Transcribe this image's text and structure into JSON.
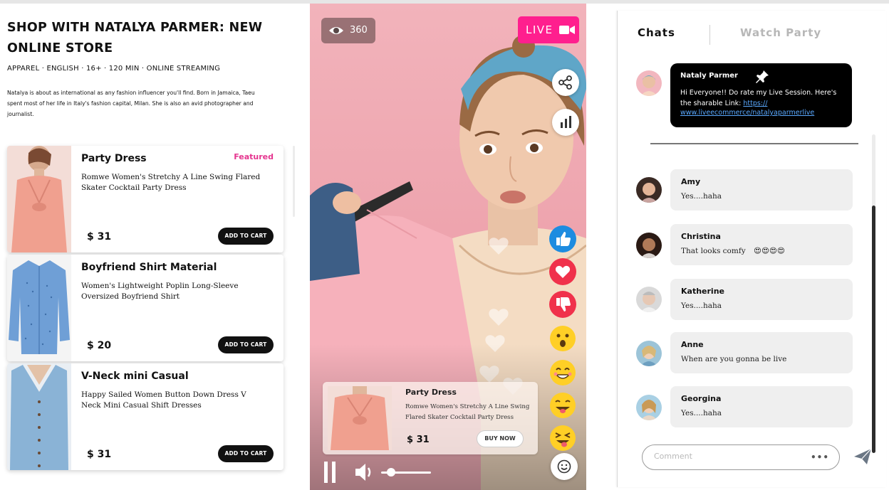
{
  "store": {
    "title": "SHOP WITH NATALYA PARMER: NEW ONLINE STORE",
    "meta": "APPAREL · ENGLISH · 16+ · 120 MIN · ONLINE STREAMING",
    "description": "Natalya is about as international as any fashion influencer you'll find. Born in Jamaica, Taeu spent most of her life in Italy's fashion capital, Milan. She is also an avid photographer and journalist."
  },
  "products": [
    {
      "name": "Party Dress",
      "badge": "Featured",
      "description": "Romwe Women's Stretchy A Line Swing Flared Skater Cocktail Party Dress",
      "price": "$ 31",
      "cart_label": "ADD TO CART"
    },
    {
      "name": "Boyfriend Shirt Material",
      "badge": "",
      "description": "Women's Lightweight Poplin Long-Sleeve Oversized Boyfriend Shirt",
      "price": "$ 20",
      "cart_label": "ADD TO CART"
    },
    {
      "name": "V-Neck mini Casual",
      "badge": "",
      "description": "Happy Sailed Women Button Down Dress V Neck Mini Casual Shift Dresses",
      "price": "$ 31",
      "cart_label": "ADD TO CART"
    }
  ],
  "video": {
    "viewer_count": "360",
    "live_label": "LIVE",
    "featured_product": {
      "name": "Party Dress",
      "description": "Romwe Women's Stretchy A Line Swing Flared Skater Cocktail Party Dress",
      "price": "$ 31",
      "buy_label": "BUY NOW"
    },
    "volume_level": 0.2,
    "reactions": [
      "thumbs-up-icon",
      "heart-icon",
      "thumbs-down-icon",
      "surprised-emoji",
      "smile-emoji",
      "tongue-emoji",
      "wink-tongue-emoji"
    ]
  },
  "chat": {
    "tabs": {
      "chats": "Chats",
      "watch_party": "Watch Party"
    },
    "pinned": {
      "author": "Nataly Parmer",
      "text": "Hi Everyone!! Do rate my Live Session. Here's the sharable Link:",
      "link_part1": "https://",
      "link_part2": "www.liveecommerce/natalyaparmerlive"
    },
    "messages": [
      {
        "user": "Amy",
        "text": "Yes....haha"
      },
      {
        "user": "Christina",
        "text": "That looks comfy",
        "emoji": "😍😍😍😍"
      },
      {
        "user": "Katherine",
        "text": "Yes....haha"
      },
      {
        "user": "Anne",
        "text": "When are you gonna be live"
      },
      {
        "user": "Georgina",
        "text": "Yes....haha"
      }
    ],
    "comment_placeholder": "Comment",
    "more_label": "•••"
  },
  "colors": {
    "accent_pink": "#ff1f8e",
    "featured_pink": "#e5358f",
    "like_blue": "#1d8ce0",
    "heart_red": "#f0314b"
  }
}
